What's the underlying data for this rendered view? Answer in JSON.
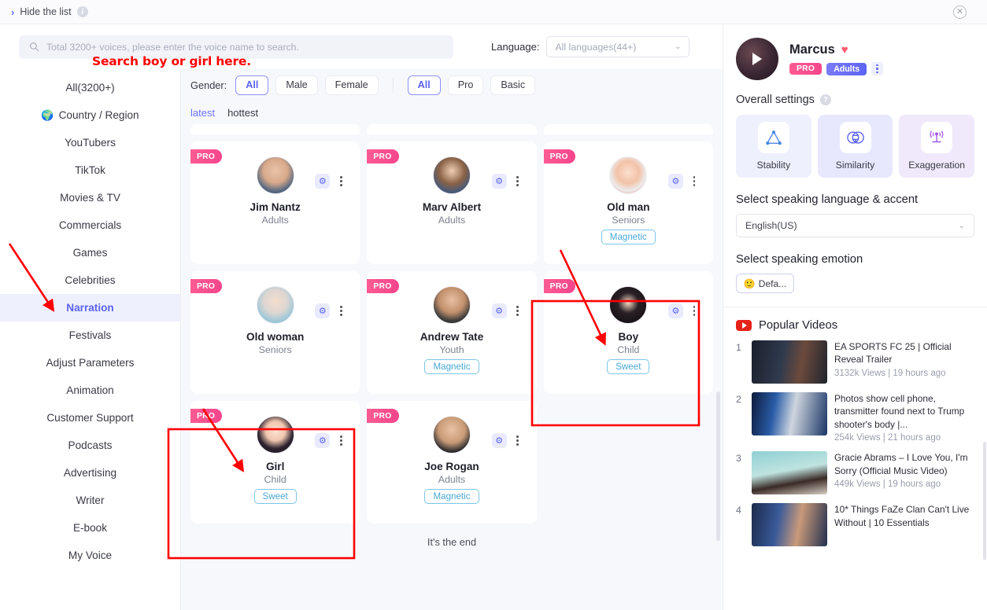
{
  "topbar": {
    "hide_label": "Hide the list",
    "chevron": "›",
    "info_icon": "i",
    "close_icon": "✕"
  },
  "search": {
    "placeholder": "Total 3200+ voices, please enter the voice name to search.",
    "value": "",
    "annotation": "Search boy or girl here."
  },
  "language_filter": {
    "label": "Language:",
    "value": "All languages(44+)",
    "chevron": "⌄"
  },
  "sidebar": {
    "items": [
      {
        "label": "All(3200+)",
        "active": false,
        "icon": ""
      },
      {
        "label": "Country / Region",
        "active": false,
        "icon": "🌍"
      },
      {
        "label": "YouTubers",
        "active": false,
        "icon": ""
      },
      {
        "label": "TikTok",
        "active": false,
        "icon": ""
      },
      {
        "label": "Movies & TV",
        "active": false,
        "icon": ""
      },
      {
        "label": "Commercials",
        "active": false,
        "icon": ""
      },
      {
        "label": "Games",
        "active": false,
        "icon": ""
      },
      {
        "label": "Celebrities",
        "active": false,
        "icon": ""
      },
      {
        "label": "Narration",
        "active": true,
        "icon": ""
      },
      {
        "label": "Festivals",
        "active": false,
        "icon": ""
      },
      {
        "label": "Adjust Parameters",
        "active": false,
        "icon": ""
      },
      {
        "label": "Animation",
        "active": false,
        "icon": ""
      },
      {
        "label": "Customer Support",
        "active": false,
        "icon": ""
      },
      {
        "label": "Podcasts",
        "active": false,
        "icon": ""
      },
      {
        "label": "Advertising",
        "active": false,
        "icon": ""
      },
      {
        "label": "Writer",
        "active": false,
        "icon": ""
      },
      {
        "label": "E-book",
        "active": false,
        "icon": ""
      },
      {
        "label": "My Voice",
        "active": false,
        "icon": ""
      }
    ]
  },
  "filters": {
    "gender_label": "Gender:",
    "gender_options": [
      "All",
      "Male",
      "Female"
    ],
    "gender_selected": "All",
    "tier_options": [
      "All",
      "Pro",
      "Basic"
    ],
    "tier_selected": "All"
  },
  "sort": {
    "options": [
      "latest",
      "hottest"
    ],
    "selected": "latest"
  },
  "grid": {
    "pro_label": "PRO",
    "gear_icon": "⚙",
    "cards": [
      {
        "name": "Jim Nantz",
        "category": "Adults",
        "tag": "",
        "pro": true
      },
      {
        "name": "Marv Albert",
        "category": "Adults",
        "tag": "",
        "pro": true
      },
      {
        "name": "Old man",
        "category": "Seniors",
        "tag": "Magnetic",
        "pro": true
      },
      {
        "name": "Old woman",
        "category": "Seniors",
        "tag": "",
        "pro": true
      },
      {
        "name": "Andrew Tate",
        "category": "Youth",
        "tag": "Magnetic",
        "pro": true
      },
      {
        "name": "Boy",
        "category": "Child",
        "tag": "Sweet",
        "pro": true
      },
      {
        "name": "Girl",
        "category": "Child",
        "tag": "Sweet",
        "pro": true
      },
      {
        "name": "Joe Rogan",
        "category": "Adults",
        "tag": "Magnetic",
        "pro": true
      }
    ],
    "end_text": "It's the end"
  },
  "voice_panel": {
    "name": "Marcus",
    "heart_icon": "♥",
    "badge_pro": "PRO",
    "badge_age": "Adults",
    "overall_settings_label": "Overall settings",
    "help_icon": "?",
    "settings": [
      {
        "label": "Stability",
        "icon": "stability-icon"
      },
      {
        "label": "Similarity",
        "icon": "similarity-icon"
      },
      {
        "label": "Exaggeration",
        "icon": "exaggeration-icon"
      }
    ],
    "language_section_title": "Select speaking language & accent",
    "language_value": "English(US)",
    "emotion_section_title": "Select speaking emotion",
    "emotion_value": "Defa...",
    "emotion_emoji": "🙂"
  },
  "popular_videos": {
    "title": "Popular Videos",
    "items": [
      {
        "rank": "1",
        "title": "EA SPORTS FC 25 | Official Reveal Trailer",
        "meta": "3132k Views | 19 hours ago"
      },
      {
        "rank": "2",
        "title": "Photos show cell phone, transmitter found next to Trump shooter's body |...",
        "meta": "254k Views | 21 hours ago"
      },
      {
        "rank": "3",
        "title": "Gracie Abrams – I Love You, I'm Sorry (Official Music Video)",
        "meta": "449k Views | 19 hours ago"
      },
      {
        "rank": "4",
        "title": "10* Things FaZe Clan Can't Live Without | 10 Essentials",
        "meta": ""
      }
    ]
  },
  "colors": {
    "accent": "#5b63f5",
    "pro_pink": "#f4448c",
    "tag_blue": "#4aa8d8",
    "annotation_red": "#ff0000"
  }
}
